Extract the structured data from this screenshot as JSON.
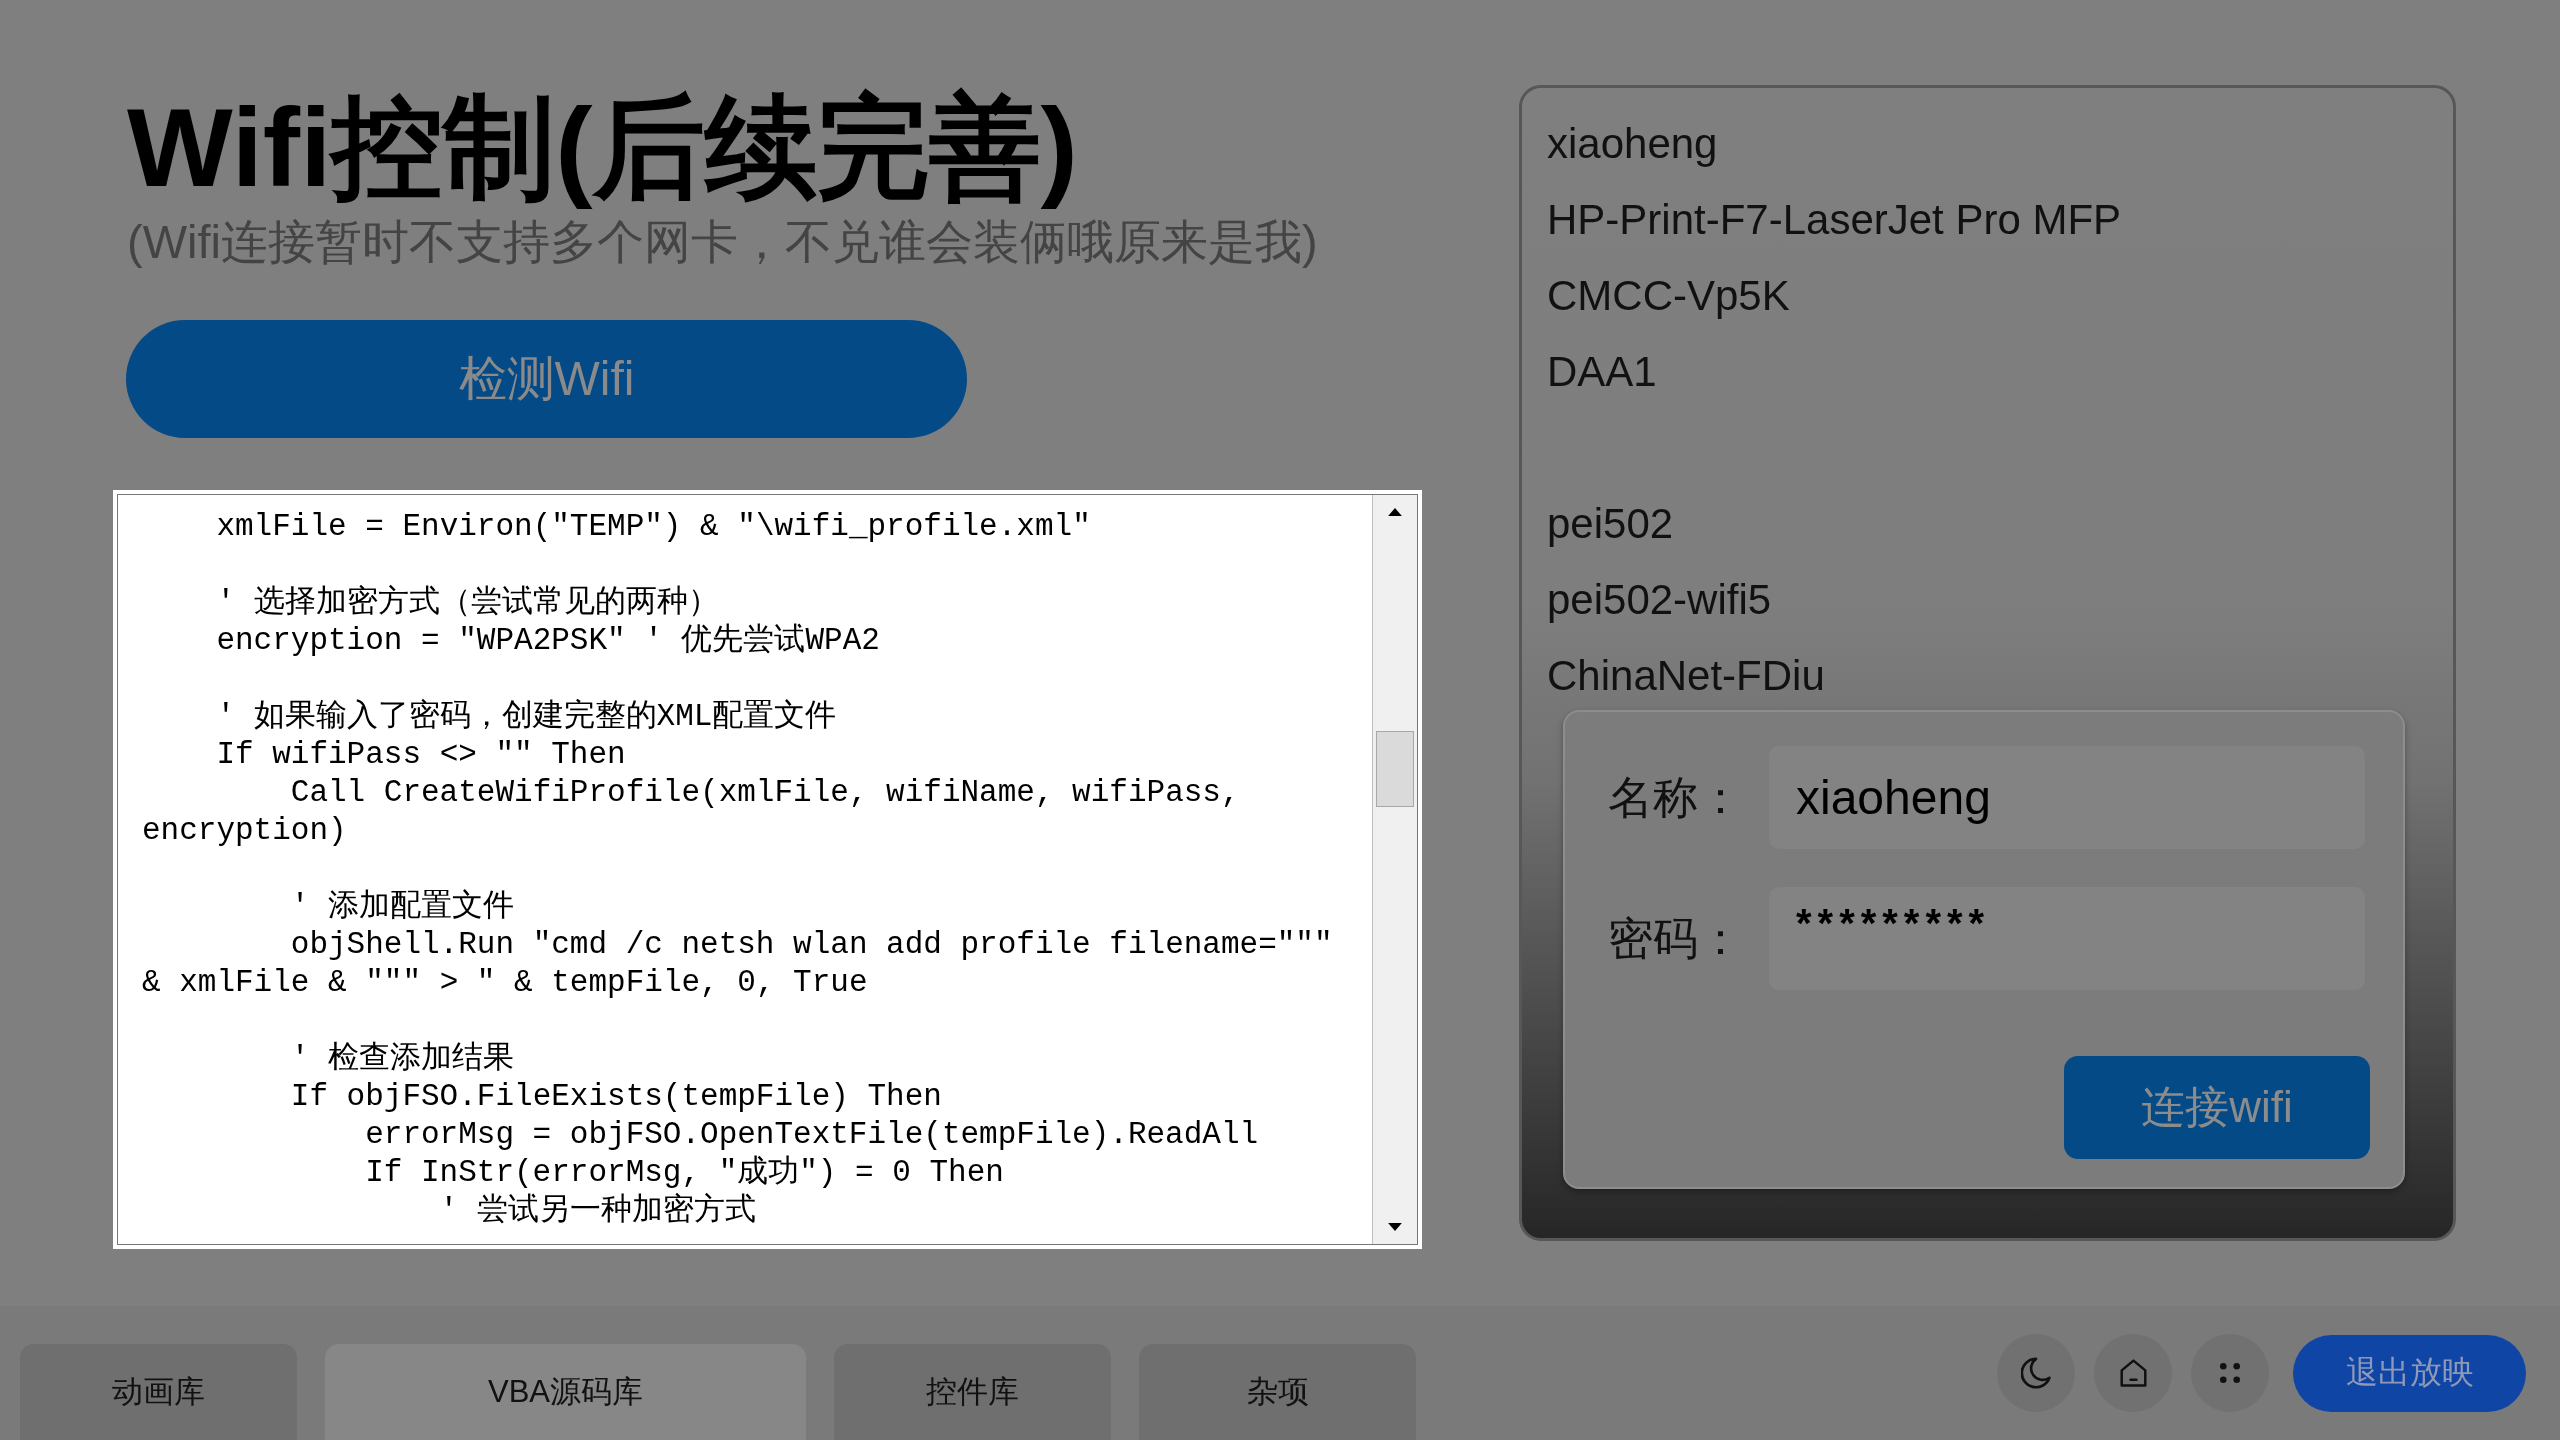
{
  "header": {
    "title": "Wifi控制(后续完善)",
    "subtitle": "(Wifi连接暂时不支持多个网卡，不兑谁会装俩哦原来是我)"
  },
  "detect_button": {
    "label": "检测Wifi"
  },
  "code_view": {
    "text": "    xmlFile = Environ(\"TEMP\") & \"\\wifi_profile.xml\"\n\n    ' 选择加密方式（尝试常见的两种）\n    encryption = \"WPA2PSK\" ' 优先尝试WPA2\n\n    ' 如果输入了密码，创建完整的XML配置文件\n    If wifiPass <> \"\" Then\n        Call CreateWifiProfile(xmlFile, wifiName, wifiPass,\nencryption)\n\n        ' 添加配置文件\n        objShell.Run \"cmd /c netsh wlan add profile filename=\"\"\"\n& xmlFile & \"\"\" > \" & tempFile, 0, True\n\n        ' 检查添加结果\n        If objFSO.FileExists(tempFile) Then\n            errorMsg = objFSO.OpenTextFile(tempFile).ReadAll\n            If InStr(errorMsg, \"成功\") = 0 Then\n                ' 尝试另一种加密方式"
  },
  "wifi_panel": {
    "networks": [
      {
        "kind": "network",
        "name": "xiaoheng"
      },
      {
        "kind": "network",
        "name": "HP-Print-F7-LaserJet Pro MFP"
      },
      {
        "kind": "network",
        "name": "CMCC-Vp5K"
      },
      {
        "kind": "network",
        "name": "DAA1"
      },
      {
        "kind": "blank"
      },
      {
        "kind": "network",
        "name": "pei502"
      },
      {
        "kind": "network",
        "name": "pei502-wifi5"
      },
      {
        "kind": "network",
        "name": "ChinaNet-FDiu"
      }
    ],
    "form": {
      "fields": [
        {
          "kind": "text",
          "label": "名称：",
          "value": "xiaoheng"
        },
        {
          "kind": "password",
          "label": "密码：",
          "value": "*********"
        }
      ],
      "button": "连接wifi"
    }
  },
  "bottom_bar": {
    "tabs": [
      {
        "label": "动画库",
        "selected": false
      },
      {
        "label": "VBA源码库",
        "selected": true
      },
      {
        "label": "控件库",
        "selected": false
      },
      {
        "label": "杂项",
        "selected": false
      }
    ],
    "exit_button": "退出放映"
  }
}
